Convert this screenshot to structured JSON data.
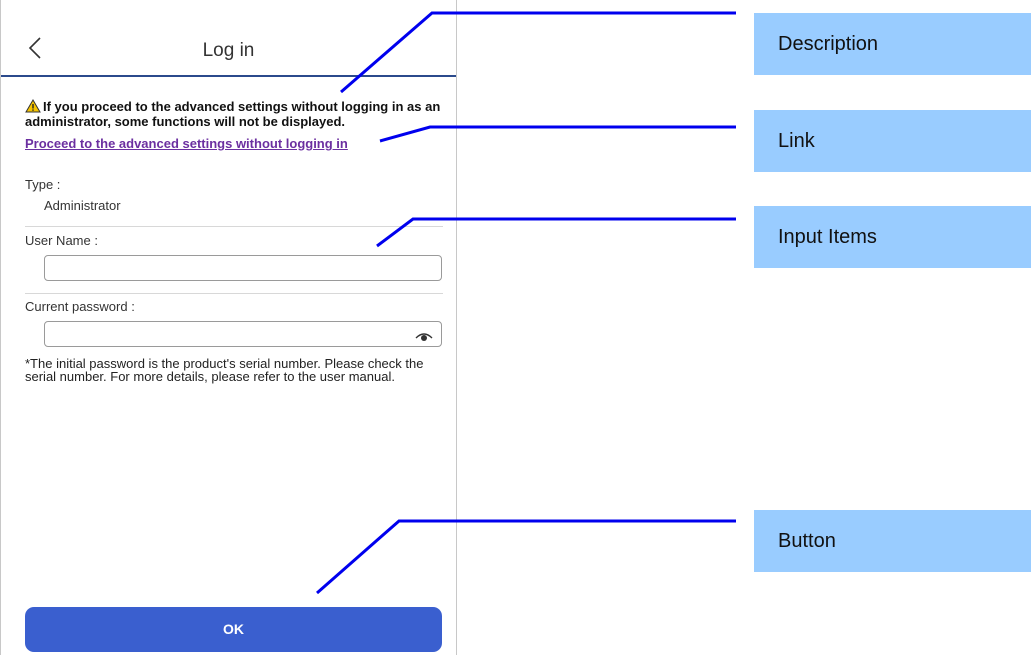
{
  "header": {
    "title": "Log in",
    "back_icon": "chevron-left-icon"
  },
  "warning": {
    "icon": "warning-triangle-icon",
    "text": "If you proceed to the advanced settings without logging in as an administrator, some functions will not be displayed."
  },
  "link": {
    "text": "Proceed to the advanced settings without logging in"
  },
  "type": {
    "label": "Type :",
    "value": "Administrator"
  },
  "username": {
    "label": "User Name :",
    "value": ""
  },
  "password": {
    "label": "Current password :",
    "value": "",
    "toggle_icon": "eye-icon"
  },
  "note": "*The initial password is the product's serial number. Please check the serial number. For more details, please refer to the user manual.",
  "ok_button": "OK",
  "callouts": {
    "description": "Description",
    "link": "Link",
    "input_items": "Input Items",
    "button": "Button"
  },
  "colors": {
    "header_rule": "#2b4a8c",
    "link": "#6b2fa0",
    "button": "#3a5fcf",
    "callout_bg": "#99ccff",
    "leader_line": "#0000ee"
  }
}
